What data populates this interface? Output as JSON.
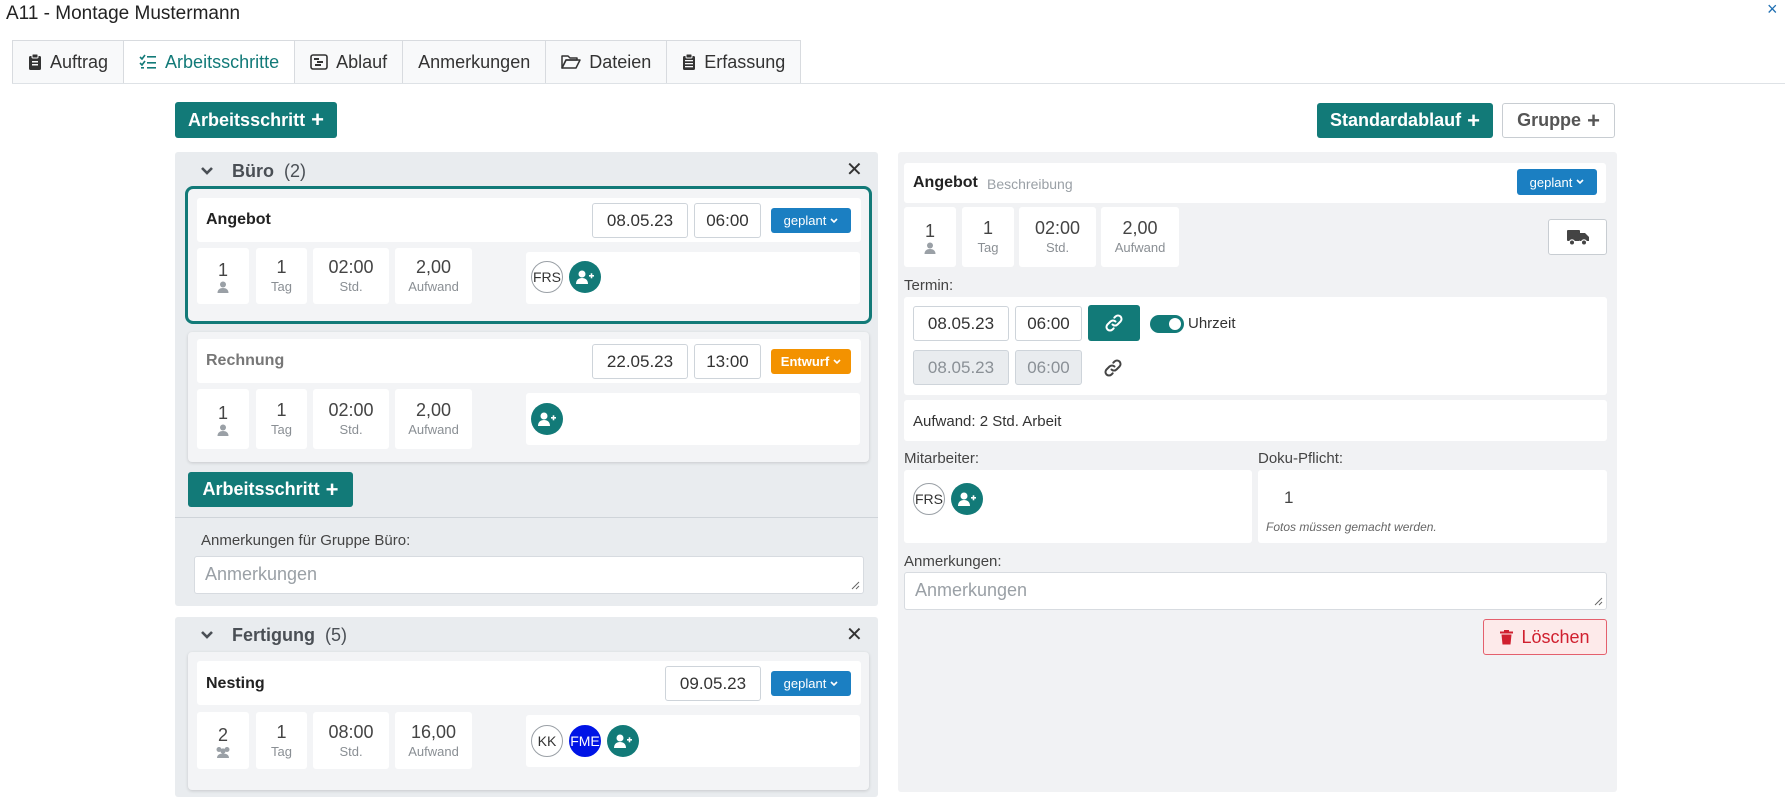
{
  "window": {
    "title": "A11 - Montage Mustermann",
    "close": "×"
  },
  "tabs": [
    {
      "label": "Auftrag",
      "icon": "clipboard-icon"
    },
    {
      "label": "Arbeitsschritte",
      "icon": "list-check-icon",
      "active": true
    },
    {
      "label": "Ablauf",
      "icon": "timeline-icon"
    },
    {
      "label": "Anmerkungen",
      "icon": ""
    },
    {
      "label": "Dateien",
      "icon": "folder-open-icon"
    },
    {
      "label": "Erfassung",
      "icon": "clipboard-list-icon"
    }
  ],
  "toolbar": {
    "add_step": "Arbeitsschritt",
    "standard_flow": "Standardablauf",
    "group": "Gruppe"
  },
  "groups": [
    {
      "title": "Büro",
      "count": "(2)",
      "add_step": "Arbeitsschritt",
      "notes_label": "Anmerkungen für Gruppe Büro:",
      "notes_placeholder": "Anmerkungen",
      "steps": [
        {
          "name": "Angebot",
          "date": "08.05.23",
          "time": "06:00",
          "status": "geplant",
          "persons": "1",
          "days": "1",
          "days_label": "Tag",
          "hours": "02:00",
          "hours_label": "Std.",
          "effort": "2,00",
          "effort_label": "Aufwand",
          "assignees": [
            "FRS"
          ]
        },
        {
          "name": "Rechnung",
          "date": "22.05.23",
          "time": "13:00",
          "status": "Entwurf",
          "persons": "1",
          "days": "1",
          "days_label": "Tag",
          "hours": "02:00",
          "hours_label": "Std.",
          "effort": "2,00",
          "effort_label": "Aufwand",
          "assignees": []
        }
      ]
    },
    {
      "title": "Fertigung",
      "count": "(5)",
      "steps": [
        {
          "name": "Nesting",
          "date": "09.05.23",
          "status": "geplant",
          "persons": "2",
          "days": "1",
          "days_label": "Tag",
          "hours": "08:00",
          "hours_label": "Std.",
          "effort": "16,00",
          "effort_label": "Aufwand",
          "assignees": [
            "KK",
            "FME"
          ]
        }
      ]
    }
  ],
  "detail": {
    "name": "Angebot",
    "description_placeholder": "Beschreibung",
    "status": "geplant",
    "persons": "1",
    "days": "1",
    "days_label": "Tag",
    "hours": "02:00",
    "hours_label": "Std.",
    "effort": "2,00",
    "effort_label": "Aufwand",
    "termin_label": "Termin:",
    "start_date": "08.05.23",
    "start_time": "06:00",
    "end_date": "08.05.23",
    "end_time": "06:00",
    "time_toggle_label": "Uhrzeit",
    "effort_text": "Aufwand: 2 Std. Arbeit",
    "employees_label": "Mitarbeiter:",
    "employees": [
      "FRS"
    ],
    "doc_label": "Doku-Pflicht:",
    "doc_value": "1",
    "doc_note": "Fotos müssen gemacht werden.",
    "notes_label": "Anmerkungen:",
    "notes_placeholder": "Anmerkungen",
    "delete": "Löschen"
  },
  "colors": {
    "teal": "#127a78",
    "blue_badge": "#1b7fc2",
    "orange_badge": "#f39200",
    "danger": "#d0202f"
  }
}
